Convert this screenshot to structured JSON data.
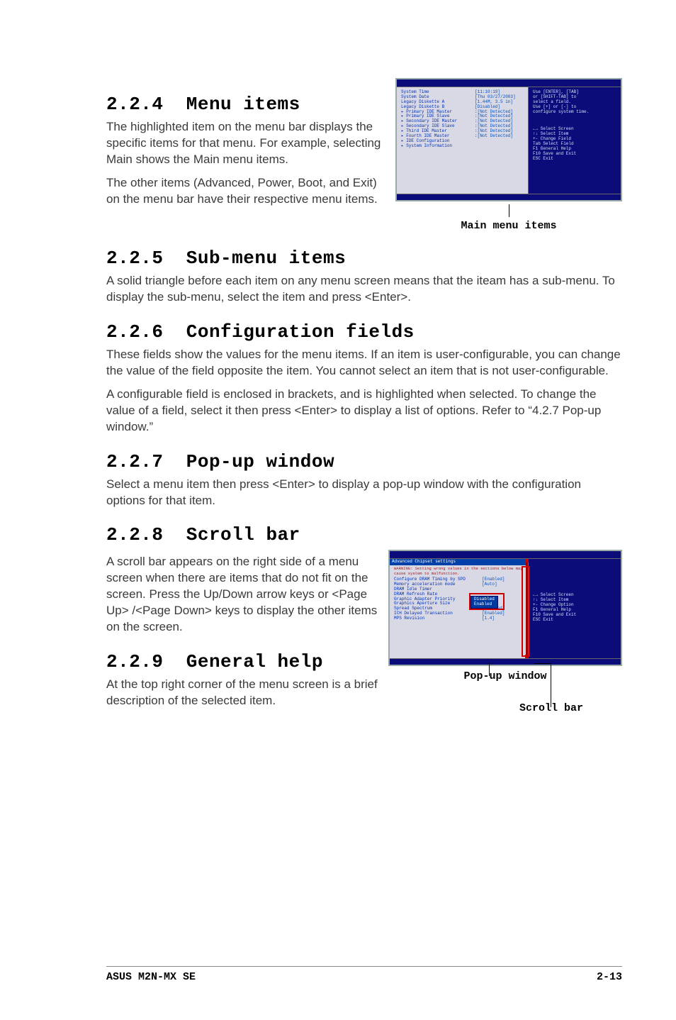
{
  "sections": {
    "s224": {
      "num": "2.2.4",
      "title": "Menu items"
    },
    "s225": {
      "num": "2.2.5",
      "title": "Sub-menu items"
    },
    "s226": {
      "num": "2.2.6",
      "title": "Configuration fields"
    },
    "s227": {
      "num": "2.2.7",
      "title": "Pop-up window"
    },
    "s228": {
      "num": "2.2.8",
      "title": "Scroll bar"
    },
    "s229": {
      "num": "2.2.9",
      "title": "General help"
    }
  },
  "paragraphs": {
    "p224a": "The highlighted item on the menu bar displays the specific items for that menu. For example, selecting Main shows the Main menu items.",
    "p224b": "The other items (Advanced, Power, Boot, and Exit) on the menu bar have their respective menu items.",
    "p225": "A solid triangle before each item on any menu screen means that the iteam has a sub-menu. To display the sub-menu, select the item and press <Enter>.",
    "p226a": "These fields show the values for the menu items. If an item is user-configurable, you can change the value of the field opposite the item. You cannot select an item that is not user-configurable.",
    "p226b": "A configurable field is enclosed in brackets, and is highlighted when selected. To change the value of a field, select it then press <Enter> to display a list of options. Refer to “4.2.7 Pop-up window.”",
    "p227": "Select a menu item then press <Enter> to display a pop-up window with the configuration options for that item.",
    "p228": "A scroll bar appears on the right side of a menu screen when there are items that do not fit on the screen. Press the Up/Down arrow keys or <Page Up> /<Page Down> keys to display the other items on the screen.",
    "p229": "At the top right corner of the menu screen is a brief description of the selected item."
  },
  "captions": {
    "main_menu_items": "Main menu items",
    "popup_window": "Pop-up window",
    "scroll_bar": "Scroll bar"
  },
  "bios1": {
    "left": [
      {
        "label": "System Time",
        "value": "[11:10:19]"
      },
      {
        "label": "System Date",
        "value": "[Thu 03/27/2003]"
      },
      {
        "label": "Legacy Diskette A",
        "value": "[1.44M, 3.5 in]"
      },
      {
        "label": "Legacy Diskette B",
        "value": "[Disabled]"
      },
      {
        "label": "",
        "value": ""
      },
      {
        "label": "▸ Primary IDE Master",
        "value": ":[Not Detected]"
      },
      {
        "label": "▸ Primary IDE Slave",
        "value": ":[Not Detected]"
      },
      {
        "label": "▸ Secondary IDE Master",
        "value": ":[Not Detected]"
      },
      {
        "label": "▸ Secondary IDE Slave",
        "value": ":[Not Detected]"
      },
      {
        "label": "▸ Third IDE Master",
        "value": ":[Not Detected]"
      },
      {
        "label": "▸ Fourth IDE Master",
        "value": ":[Not Detected]"
      },
      {
        "label": "▸ IDE Configuration",
        "value": ""
      },
      {
        "label": "",
        "value": ""
      },
      {
        "label": "▸ System Information",
        "value": ""
      }
    ],
    "right_top": [
      "Use [ENTER], [TAB]",
      "or [SHIFT-TAB] to",
      "select a field.",
      "",
      "Use [+] or [-] to",
      "configure system time."
    ],
    "right_keys": [
      "←→  Select Screen",
      "↑↓  Select Item",
      "+-  Change Field",
      "Tab Select Field",
      "F1  General Help",
      "F10 Save and Exit",
      "ESC Exit"
    ]
  },
  "bios2": {
    "header": "Advanced Chipset settings",
    "warning": "WARNING: Setting wrong values in the sections below may cause system to malfunction.",
    "left": [
      {
        "label": "Configure DRAM Timing by SPD",
        "value": "[Enabled]"
      },
      {
        "label": "Memory acceleration mode",
        "value": "[Auto]"
      },
      {
        "label": "DRAM Idle Timer",
        "value": ""
      },
      {
        "label": "DRAM Refresh Rate",
        "value": ""
      },
      {
        "label": "",
        "value": ""
      },
      {
        "label": "Graphic Adapter Priority",
        "value": ""
      },
      {
        "label": "Graphics Aperture Size",
        "value": ""
      },
      {
        "label": "Spread Spectrum",
        "value": "[Enabled]"
      },
      {
        "label": "",
        "value": ""
      },
      {
        "label": "ICH Delayed Transaction",
        "value": "[Enabled]"
      },
      {
        "label": "",
        "value": ""
      },
      {
        "label": "MPS Revision",
        "value": "[1.4]"
      }
    ],
    "dropdown": [
      "Disabled",
      "Enabled"
    ],
    "right_keys": [
      "←→  Select Screen",
      "↑↓  Select Item",
      "+-  Change Option",
      "F1  General Help",
      "F10 Save and Exit",
      "ESC Exit"
    ]
  },
  "footer": {
    "left": "ASUS M2N-MX SE",
    "right": "2-13"
  }
}
